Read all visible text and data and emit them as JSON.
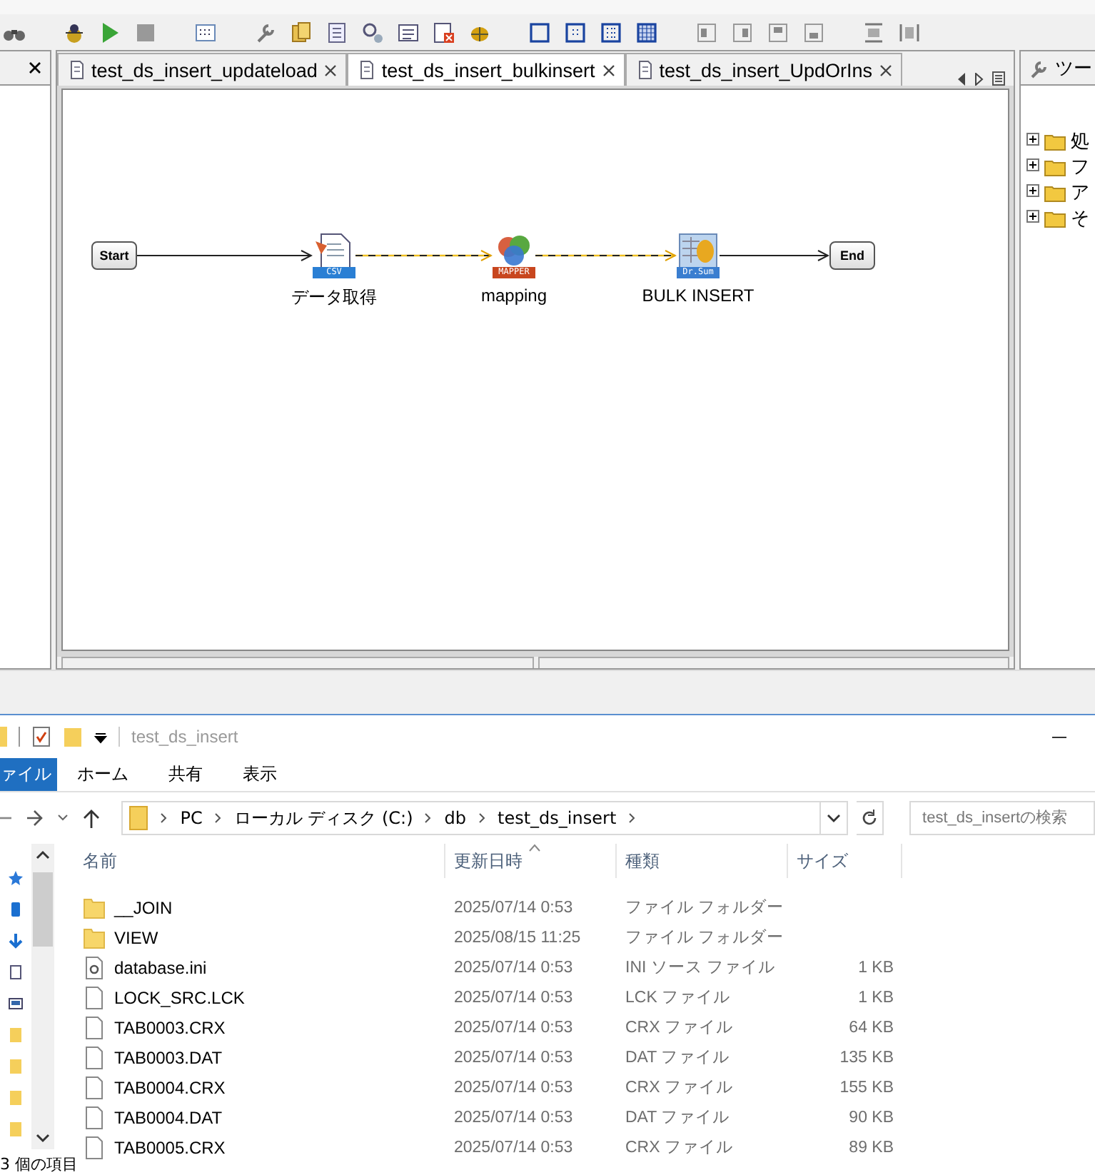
{
  "editor": {
    "tabs": [
      {
        "label": "test_ds_insert_updateload",
        "selected": false
      },
      {
        "label": "test_ds_insert_bulkinsert",
        "selected": true
      },
      {
        "label": "test_ds_insert_UpdOrIns",
        "selected": false
      }
    ],
    "nodes": [
      {
        "kind": "terminal",
        "label": "Start"
      },
      {
        "kind": "csv",
        "label": "データ取得",
        "badge": "CSV"
      },
      {
        "kind": "mapper",
        "label": "mapping",
        "badge": "MAPPER"
      },
      {
        "kind": "drsum",
        "label": "BULK INSERT",
        "badge": "Dr.Sum"
      },
      {
        "kind": "terminal",
        "label": "End"
      }
    ],
    "links": [
      {
        "kind": "solid"
      },
      {
        "kind": "dashed"
      },
      {
        "kind": "dashed"
      },
      {
        "kind": "solid"
      }
    ]
  },
  "tool_panel": {
    "title": "ツー",
    "items": [
      {
        "label": "処",
        "expanded": false
      },
      {
        "label": "フ",
        "expanded": false
      },
      {
        "label": "ア",
        "expanded": false
      },
      {
        "label": "そ",
        "expanded": false
      }
    ]
  },
  "explorer": {
    "title": "test_ds_insert",
    "ribbon_tabs": [
      {
        "label": "ァイル",
        "selected": true
      },
      {
        "label": "ホーム",
        "selected": false
      },
      {
        "label": "共有",
        "selected": false
      },
      {
        "label": "表示",
        "selected": false
      }
    ],
    "path": [
      "PC",
      "ローカル ディスク (C:)",
      "db",
      "test_ds_insert"
    ],
    "search": {
      "placeholder": "test_ds_insertの検索"
    },
    "columns": [
      "名前",
      "更新日時",
      "種類",
      "サイズ"
    ],
    "rows": [
      {
        "kind": "folder",
        "name": "__JOIN",
        "date": "2025/07/14 0:53",
        "type": "ファイル フォルダー"
      },
      {
        "kind": "folder",
        "name": "VIEW",
        "date": "2025/08/15 11:25",
        "type": "ファイル フォルダー"
      },
      {
        "kind": "settings",
        "name": "database.ini",
        "date": "2025/07/14 0:53",
        "type": "INI ソース ファイル",
        "size": "1 KB"
      },
      {
        "kind": "file",
        "name": "LOCK_SRC.LCK",
        "date": "2025/07/14 0:53",
        "type": "LCK ファイル",
        "size": "1 KB"
      },
      {
        "kind": "file",
        "name": "TAB0003.CRX",
        "date": "2025/07/14 0:53",
        "type": "CRX ファイル",
        "size": "64 KB"
      },
      {
        "kind": "file",
        "name": "TAB0003.DAT",
        "date": "2025/07/14 0:53",
        "type": "DAT ファイル",
        "size": "135 KB"
      },
      {
        "kind": "file",
        "name": "TAB0004.CRX",
        "date": "2025/07/14 0:53",
        "type": "CRX ファイル",
        "size": "155 KB"
      },
      {
        "kind": "file",
        "name": "TAB0004.DAT",
        "date": "2025/07/14 0:53",
        "type": "DAT ファイル",
        "size": "90 KB"
      },
      {
        "kind": "file",
        "name": "TAB0005.CRX",
        "date": "2025/07/14 0:53",
        "type": "CRX ファイル",
        "size": "89 KB"
      }
    ],
    "status": "3 個の項目"
  }
}
